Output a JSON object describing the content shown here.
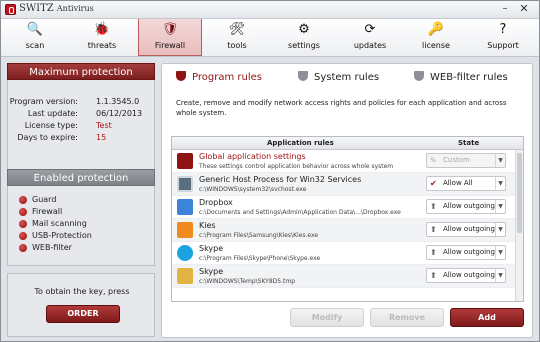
{
  "window": {
    "title_main": "SWITZ",
    "title_sub": "Antivirus",
    "minimize": "–",
    "close": "✕"
  },
  "toolbar": {
    "items": [
      {
        "label": "scan",
        "icon": "🔍"
      },
      {
        "label": "threats",
        "icon": "🐞"
      },
      {
        "label": "Firewall",
        "icon": "🛡"
      },
      {
        "label": "tools",
        "icon": "🛠"
      },
      {
        "label": "settings",
        "icon": "⚙"
      },
      {
        "label": "updates",
        "icon": "⟳"
      },
      {
        "label": "license",
        "icon": "🔑"
      },
      {
        "label": "Support",
        "icon": "?"
      }
    ],
    "active": "Firewall"
  },
  "protection": {
    "header": "Maximum protection",
    "program_version_label": "Program version:",
    "program_version": "1.1.3545.0",
    "last_update_label": "Last update:",
    "last_update": "06/12/2013",
    "license_type_label": "License type:",
    "license_type": "Test",
    "days_label": "Days to expire:",
    "days": "15"
  },
  "enabled": {
    "header": "Enabled protection",
    "items": [
      "Guard",
      "Firewall",
      "Mail scanning",
      "USB-Protection",
      "WEB-filter"
    ]
  },
  "key": {
    "text": "To obtain the key, press",
    "order_label": "ORDER"
  },
  "tabs": [
    {
      "label": "Program rules"
    },
    {
      "label": "System rules"
    },
    {
      "label": "WEB-filter rules"
    }
  ],
  "description": "Create, remove and modify network access rights and policies for each application and across whole system.",
  "table": {
    "col_rules": "Application rules",
    "col_state": "State",
    "rows": [
      {
        "name": "Global application settings",
        "path": "These settings control application behavior across whole system",
        "state": "Custom",
        "state_icon": "✎"
      },
      {
        "name": "Generic Host Process for Win32 Services",
        "path": "c:\\WINDOWS\\system32\\svchost.exe",
        "state": "Allow All",
        "state_icon": "✔"
      },
      {
        "name": "Dropbox",
        "path": "c:\\Documents and Settings\\Admin\\Application Data\\...\\Dropbox.exe",
        "state": "Allow outgoing",
        "state_icon": "⬆"
      },
      {
        "name": "Kies",
        "path": "c:\\Program Files\\Samsung\\Kies\\Kies.exe",
        "state": "Allow outgoing",
        "state_icon": "⬆"
      },
      {
        "name": "Skype",
        "path": "c:\\Program Files\\Skype\\Phone\\Skype.exe",
        "state": "Allow outgoing",
        "state_icon": "⬆"
      },
      {
        "name": "Skype",
        "path": "c:\\WINDOWS\\Temp\\SKY8D5.tmp",
        "state": "Allow outgoing",
        "state_icon": "⬆"
      }
    ]
  },
  "buttons": {
    "modify": "Modify",
    "remove": "Remove",
    "add": "Add"
  },
  "colors": {
    "brand_red": "#8e1414",
    "header_grey": "#7d8086"
  }
}
